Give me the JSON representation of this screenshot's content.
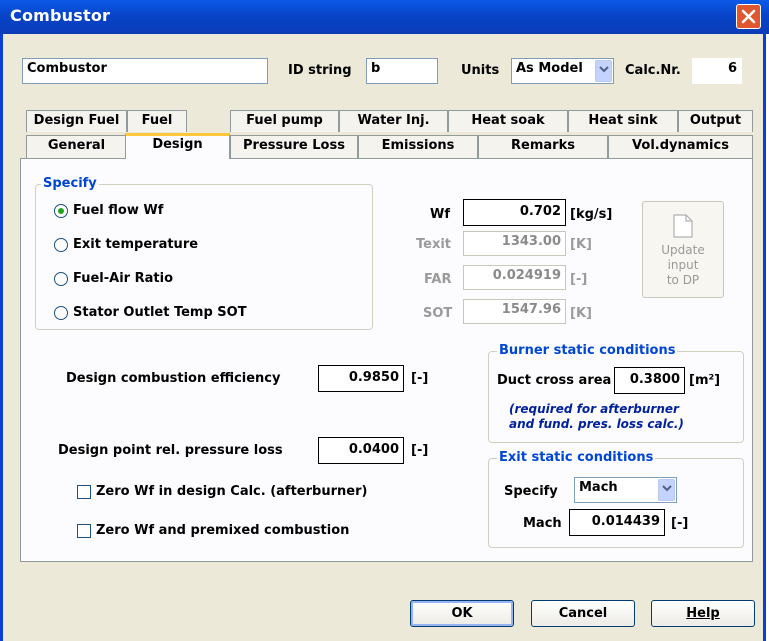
{
  "window": {
    "title": "Combustor"
  },
  "header": {
    "name_value": "Combustor",
    "id_label": "ID string",
    "id_value": "b",
    "units_label": "Units",
    "units_value": "As Model",
    "calc_label": "Calc.Nr.",
    "calc_value": "6"
  },
  "tabs_row1": [
    "Design Fuel",
    "Fuel",
    "Fuel pump",
    "Water Inj.",
    "Heat soak",
    "Heat sink",
    "Output"
  ],
  "tabs_row2": [
    "General",
    "Design",
    "Pressure Loss",
    "Emissions",
    "Remarks",
    "Vol.dynamics"
  ],
  "active_tab": "Design",
  "specify": {
    "title": "Specify",
    "options": [
      "Fuel flow Wf",
      "Exit temperature",
      "Fuel-Air Ratio",
      "Stator Outlet Temp SOT"
    ],
    "selected": "Fuel flow Wf"
  },
  "params": [
    {
      "label": "Wf",
      "value": "0.702",
      "unit": "[kg/s]",
      "enabled": true
    },
    {
      "label": "Texit",
      "value": "1343.00",
      "unit": "[K]",
      "enabled": false
    },
    {
      "label": "FAR",
      "value": "0.024919",
      "unit": "[-]",
      "enabled": false
    },
    {
      "label": "SOT",
      "value": "1547.96",
      "unit": "[K]",
      "enabled": false
    }
  ],
  "update_button": {
    "label": "Update\ninput\nto DP"
  },
  "efficiency": {
    "label": "Design combustion efficiency",
    "value": "0.9850",
    "unit": "[-]"
  },
  "pressure_loss": {
    "label": "Design point rel. pressure loss",
    "value": "0.0400",
    "unit": "[-]"
  },
  "checkboxes": [
    {
      "label": "Zero Wf in design Calc. (afterburner)",
      "checked": false
    },
    {
      "label": "Zero Wf and premixed combustion",
      "checked": false
    }
  ],
  "burner_static": {
    "title": "Burner static conditions",
    "label": "Duct cross area",
    "value": "0.3800",
    "unit": "[m²]",
    "note": "(required for afterburner\n and fund. pres. loss calc.)"
  },
  "exit_static": {
    "title": "Exit static conditions",
    "specify_label": "Specify",
    "specify_value": "Mach",
    "mach_label": "Mach",
    "mach_value": "0.014439",
    "mach_unit": "[-]"
  },
  "buttons": {
    "ok": "OK",
    "cancel": "Cancel",
    "help": "Help"
  },
  "colors": {
    "title_bar": "#0a4fe0",
    "group_title": "#0046d5",
    "radio_dot": "#21a121",
    "active_tab_accent": "#ffc83c"
  }
}
